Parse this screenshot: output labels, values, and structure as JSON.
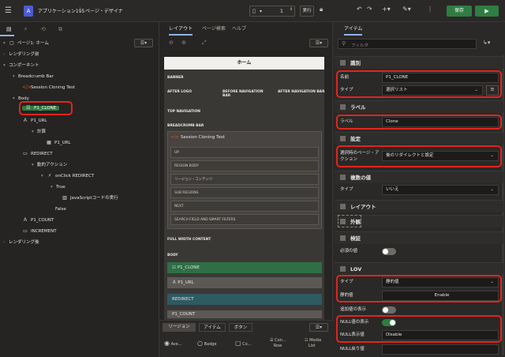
{
  "header": {
    "app_badge": "A",
    "app_name": "アプリケーション195",
    "page_title": "ページ・デザイナ",
    "page_number": "1",
    "run_label": "実行",
    "save_label": "保存"
  },
  "left_tree": {
    "root": "ページ1: ホーム",
    "rows": [
      "レンダリング前",
      "コンポーネント",
      "Breadcrumb Bar",
      "Session Cloning Test",
      "Body",
      "P1_CLONE",
      "P1_URL",
      "計算",
      "P1_URL",
      "REDIRECT",
      "動的アクション",
      "onClick REDIRECT",
      "True",
      "JavaScriptコードの実行",
      "False",
      "P1_COUNT",
      "INCREMENT",
      "レンダリング後"
    ]
  },
  "middle": {
    "tabs": [
      "レイアウト",
      "ページ検索",
      "ヘルプ"
    ],
    "page_header": "ホーム",
    "labels": {
      "banner": "BANNER",
      "after_logo": "AFTER LOGO",
      "before_nav": "BEFORE NAVIGATION BAR",
      "after_nav": "AFTER NAVIGATION BAR",
      "top_nav": "TOP NAVIGATION",
      "breadcrumb_bar": "BREADCRUMB BAR",
      "full_width": "FULL WIDTH CONTENT",
      "body": "BODY"
    },
    "region_title": "Session Cloning Test",
    "sub_rows": [
      "UP",
      "REGION BODY",
      "リージョン・コンテンツ",
      "SUB REGIONS",
      "NEXT",
      "SEARCH FIELD AND SMART FILTERS"
    ],
    "body_items": [
      "P1_CLONE",
      "P1_URL",
      "REDIRECT",
      "P1_COUNT"
    ],
    "gallery_tabs": [
      "リージョン",
      "アイテム",
      "ボタン"
    ],
    "gallery_items": [
      "Ave...",
      "Badge",
      "Co...",
      "Con...",
      "Row",
      "Media",
      "List"
    ]
  },
  "right": {
    "tab": "アイテム",
    "filter_placeholder": "フィルタ",
    "sections": {
      "identification": "識別",
      "label": "ラベル",
      "settings": "設定",
      "multiple": "複数の値",
      "layout": "レイアウト",
      "appearance": "外観",
      "validation": "検証",
      "lov": "LOV"
    },
    "props": {
      "name_label": "名前",
      "name_value": "P1_CLONE",
      "type_label": "タイプ",
      "type_value": "選択リスト",
      "label_label": "ラベル",
      "label_value": "Clone",
      "page_action_label": "選択時のページ・アクション",
      "page_action_value": "後のリダイレクトと設定",
      "multi_type_label": "タイプ",
      "multi_type_value": "いいえ",
      "required_label": "必須の値",
      "lov_type_label": "タイプ",
      "lov_type_value": "静的値",
      "static_label": "静的値",
      "static_value": "Enable",
      "extra_label": "追加値の表示",
      "null_display_label": "NULL値の表示",
      "null_display_value_label": "NULL表示値",
      "null_display_value": "Disable",
      "null_return_label": "NULL戻り値"
    }
  }
}
